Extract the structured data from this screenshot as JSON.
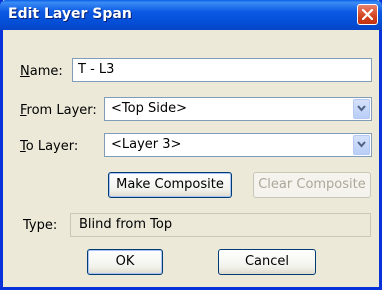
{
  "window": {
    "title": "Edit Layer Span",
    "close_icon": "close-icon"
  },
  "form": {
    "name_label_accel": "N",
    "name_label_rest": "ame:",
    "name_value": "T - L3",
    "from_label_accel": "F",
    "from_label_rest": "rom Layer:",
    "from_value": "<Top Side>",
    "to_label_accel": "T",
    "to_label_rest": "o Layer:",
    "to_value": "<Layer 3>",
    "make_composite_label": "Make Composite",
    "clear_composite_label": "Clear Composite",
    "type_label": "Type:",
    "type_value": "Blind from Top"
  },
  "buttons": {
    "ok_label": "OK",
    "cancel_label": "Cancel"
  },
  "colors": {
    "titlebar": "#0b58e3",
    "dialog_bg": "#ece9d8",
    "close": "#d3431f"
  }
}
